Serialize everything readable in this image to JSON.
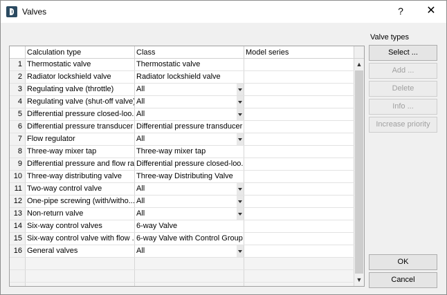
{
  "window": {
    "title": "Valves",
    "help": "?",
    "close": "✕"
  },
  "grid": {
    "columns": [
      "Calculation type",
      "Class",
      "Model series"
    ],
    "rows": [
      {
        "num": "1",
        "type": "Thermostatic valve",
        "cls": "Thermostatic valve",
        "combo": false,
        "model": ""
      },
      {
        "num": "2",
        "type": "Radiator lockshield valve",
        "cls": "Radiator lockshield valve",
        "combo": false,
        "model": ""
      },
      {
        "num": "3",
        "type": "Regulating valve (throttle)",
        "cls": "All",
        "combo": true,
        "model": ""
      },
      {
        "num": "4",
        "type": "Regulating valve (shut-off valve)",
        "cls": "All",
        "combo": true,
        "model": ""
      },
      {
        "num": "5",
        "type": "Differential pressure closed-loo...",
        "cls": "All",
        "combo": true,
        "model": ""
      },
      {
        "num": "6",
        "type": "Differential pressure transducer",
        "cls": "Differential pressure transducer",
        "combo": false,
        "model": ""
      },
      {
        "num": "7",
        "type": "Flow regulator",
        "cls": "All",
        "combo": true,
        "model": ""
      },
      {
        "num": "8",
        "type": "Three-way mixer tap",
        "cls": "Three-way mixer tap",
        "combo": false,
        "model": ""
      },
      {
        "num": "9",
        "type": "Differential pressure and flow ra...",
        "cls": "Differential pressure closed-loo...",
        "combo": false,
        "model": ""
      },
      {
        "num": "10",
        "type": "Three-way distributing valve",
        "cls": "Three-way Distributing Valve",
        "combo": false,
        "model": ""
      },
      {
        "num": "11",
        "type": "Two-way control valve",
        "cls": "All",
        "combo": true,
        "model": ""
      },
      {
        "num": "12",
        "type": "One-pipe screwing (with/witho...",
        "cls": "All",
        "combo": true,
        "model": ""
      },
      {
        "num": "13",
        "type": "Non-return valve",
        "cls": "All",
        "combo": true,
        "model": ""
      },
      {
        "num": "14",
        "type": "Six-way control valves",
        "cls": "6-way Valve",
        "combo": false,
        "model": ""
      },
      {
        "num": "15",
        "type": "Six-way control valve with flow ...",
        "cls": "6-way Valve with Control Group",
        "combo": false,
        "model": ""
      },
      {
        "num": "16",
        "type": "General valves",
        "cls": "All",
        "combo": true,
        "model": ""
      }
    ]
  },
  "side": {
    "label": "Valve types",
    "buttons": [
      {
        "label": "Select ...",
        "enabled": true
      },
      {
        "label": "Add ...",
        "enabled": false
      },
      {
        "label": "Delete",
        "enabled": false
      },
      {
        "label": "Info ...",
        "enabled": false
      },
      {
        "label": "Increase priority",
        "enabled": false
      }
    ]
  },
  "footer": {
    "ok": "OK",
    "cancel": "Cancel"
  },
  "icons": {
    "scroll_up": "▲",
    "scroll_down": "▼"
  }
}
